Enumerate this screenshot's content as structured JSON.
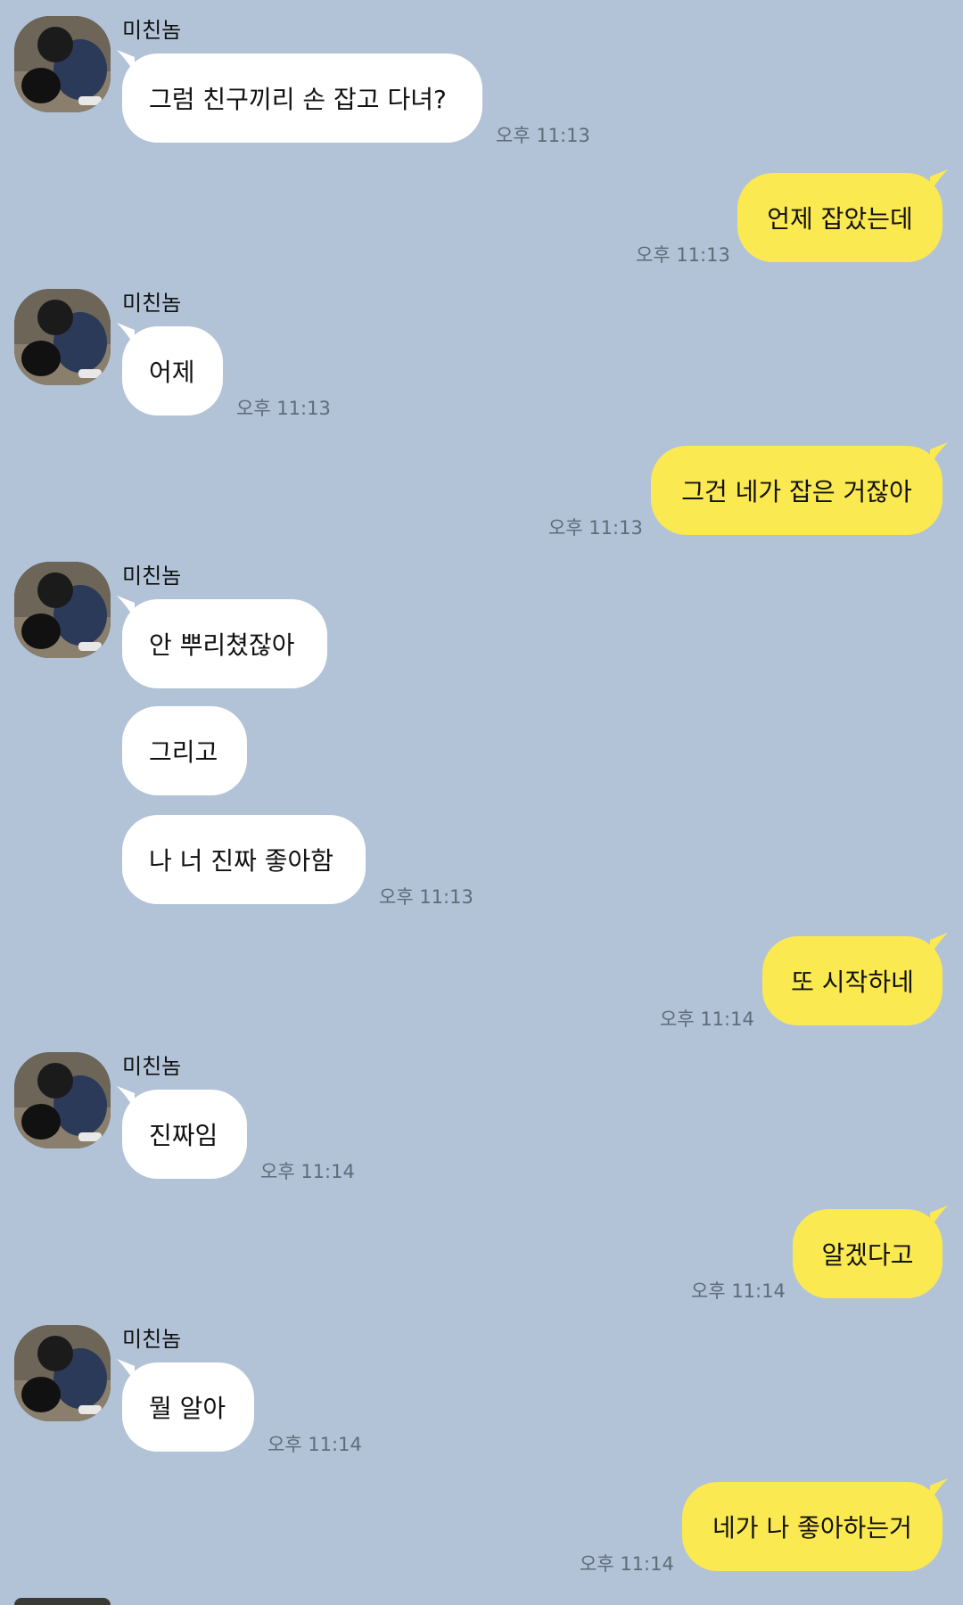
{
  "chat": {
    "contact_name": "미친놈",
    "messages": [
      {
        "side": "in",
        "text": "그럼 친구끼리 손 잡고 다녀?",
        "time": "오후 11:13"
      },
      {
        "side": "out",
        "text": "언제 잡았는데",
        "time": "오후 11:13"
      },
      {
        "side": "in",
        "text": "어제",
        "time": "오후 11:13"
      },
      {
        "side": "out",
        "text": "그건 네가 잡은 거잖아",
        "time": "오후 11:13"
      },
      {
        "side": "in",
        "text": "안 뿌리쳤잖아",
        "time": ""
      },
      {
        "side": "in",
        "text": "그리고",
        "time": ""
      },
      {
        "side": "in",
        "text": "나 너 진짜 좋아함",
        "time": "오후 11:13"
      },
      {
        "side": "out",
        "text": "또 시작하네",
        "time": "오후 11:14"
      },
      {
        "side": "in",
        "text": "진짜임",
        "time": "오후 11:14"
      },
      {
        "side": "out",
        "text": "알겠다고",
        "time": "오후 11:14"
      },
      {
        "side": "in",
        "text": "뭘 알아",
        "time": "오후 11:14"
      },
      {
        "side": "out",
        "text": "네가 나 좋아하는거",
        "time": "오후 11:14"
      }
    ]
  },
  "colors": {
    "background": "#b2c3d7",
    "incoming_bubble": "#ffffff",
    "outgoing_bubble": "#fbe952",
    "timestamp": "#5f6b79"
  },
  "icons": {
    "avatar": "profile-photo"
  }
}
